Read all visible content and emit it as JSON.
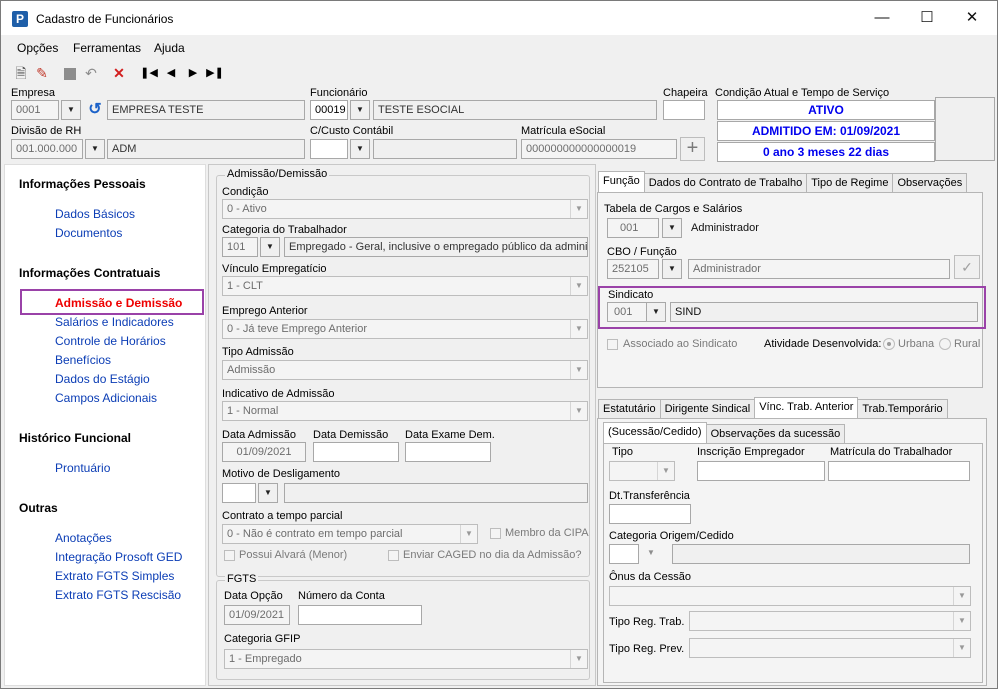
{
  "window": {
    "title": "Cadastro de Funcionários",
    "app_icon": "P"
  },
  "menu": {
    "opcoes": "Opções",
    "ferramentas": "Ferramentas",
    "ajuda": "Ajuda"
  },
  "toolbar_icons": [
    "new-doc-icon",
    "edit-icon",
    "save-icon",
    "undo-icon",
    "delete-icon",
    "first-record-icon",
    "prev-record-icon",
    "next-record-icon",
    "last-record-icon"
  ],
  "header": {
    "empresa_label": "Empresa",
    "empresa_code": "0001",
    "empresa_name": "EMPRESA TESTE",
    "funcionario_label": "Funcionário",
    "funcionario_code": "00019",
    "funcionario_name": "TESTE ESOCIAL",
    "chapeira_label": "Chapeira",
    "chapeira_value": "",
    "condicao_label": "Condição Atual e Tempo de Serviço",
    "status": "ATIVO",
    "admitido": "ADMITIDO EM: 01/09/2021",
    "tempo": "0 ano 3 meses 22 dias",
    "divisao_label": "Divisão de RH",
    "divisao_code": "001.000.000",
    "divisao_name": "ADM",
    "ccusto_label": "C/Custo Contábil",
    "ccusto_code": "",
    "ccusto_name": "",
    "matricula_label": "Matrícula eSocial",
    "matricula_value": "000000000000000019"
  },
  "sidebar": {
    "pessoais": {
      "title": "Informações Pessoais",
      "items": [
        "Dados Básicos",
        "Documentos"
      ]
    },
    "contratuais": {
      "title": "Informações Contratuais",
      "items": [
        "Admissão e Demissão",
        "Salários e Indicadores",
        "Controle de Horários",
        "Benefícios",
        "Dados do Estágio",
        "Campos Adicionais"
      ]
    },
    "historico": {
      "title": "Histórico Funcional",
      "items": [
        "Prontuário"
      ]
    },
    "outras": {
      "title": "Outras",
      "items": [
        "Anotações",
        "Integração Prosoft GED",
        "Extrato FGTS Simples",
        "Extrato FGTS Rescisão"
      ]
    }
  },
  "admissao": {
    "group_title": "Admissão/Demissão",
    "condicao_label": "Condição",
    "condicao_value": "0 - Ativo",
    "categoria_label": "Categoria do Trabalhador",
    "categoria_code": "101",
    "categoria_desc": "Empregado - Geral, inclusive o empregado público da administ",
    "vinculo_label": "Vínculo Empregatício",
    "vinculo_value": "1 - CLT",
    "emprego_ant_label": "Emprego Anterior",
    "emprego_ant_value": "0 - Já teve Emprego Anterior",
    "tipo_adm_label": "Tipo Admissão",
    "tipo_adm_value": "Admissão",
    "indicativo_label": "Indicativo de Admissão",
    "indicativo_value": "1 - Normal",
    "data_adm_label": "Data Admissão",
    "data_adm_value": "01/09/2021",
    "data_dem_label": "Data Demissão",
    "data_dem_value": "",
    "data_exame_label": "Data Exame Dem.",
    "data_exame_value": "",
    "motivo_label": "Motivo de Desligamento",
    "contrato_label": "Contrato a tempo parcial",
    "contrato_value": "0 - Não é contrato em tempo parcial",
    "membro_cipa": "Membro da CIPA",
    "alvara": "Possui Alvará (Menor)",
    "caged": "Enviar CAGED no dia da Admissão?"
  },
  "fgts": {
    "group_title": "FGTS",
    "data_opcao_label": "Data Opção",
    "data_opcao_value": "01/09/2021",
    "conta_label": "Número da Conta",
    "conta_value": "",
    "categoria_label": "Categoria GFIP",
    "categoria_value": "1 - Empregado"
  },
  "right_top": {
    "tabs": [
      "Função",
      "Dados do Contrato de Trabalho",
      "Tipo de Regime",
      "Observações"
    ],
    "tabela_label": "Tabela de Cargos e Salários",
    "tabela_code": "001",
    "tabela_desc": "Administrador",
    "cbo_label": "CBO / Função",
    "cbo_code": "252105",
    "cbo_desc": "Administrador",
    "sindicato_label": "Sindicato",
    "sindicato_code": "001",
    "sindicato_desc": "SIND",
    "associado": "Associado ao Sindicato",
    "atividade_label": "Atividade Desenvolvida:",
    "urbana": "Urbana",
    "rural": "Rural"
  },
  "right_bottom": {
    "tabs": [
      "Estatutário",
      "Dirigente Sindical",
      "Vínc. Trab. Anterior",
      "Trab.Temporário"
    ],
    "subtabs": [
      "(Sucessão/Cedido)",
      "Observações da sucessão"
    ],
    "tipo_label": "Tipo",
    "inscricao_label": "Inscrição Empregador",
    "matricula_label": "Matrícula do Trabalhador",
    "dt_transf_label": "Dt.Transferência",
    "categoria_origem_label": "Categoria Origem/Cedido",
    "onus_label": "Ônus da Cessão",
    "tipo_reg_trab_label": "Tipo Reg. Trab.",
    "tipo_reg_prev_label": "Tipo Reg. Prev."
  }
}
